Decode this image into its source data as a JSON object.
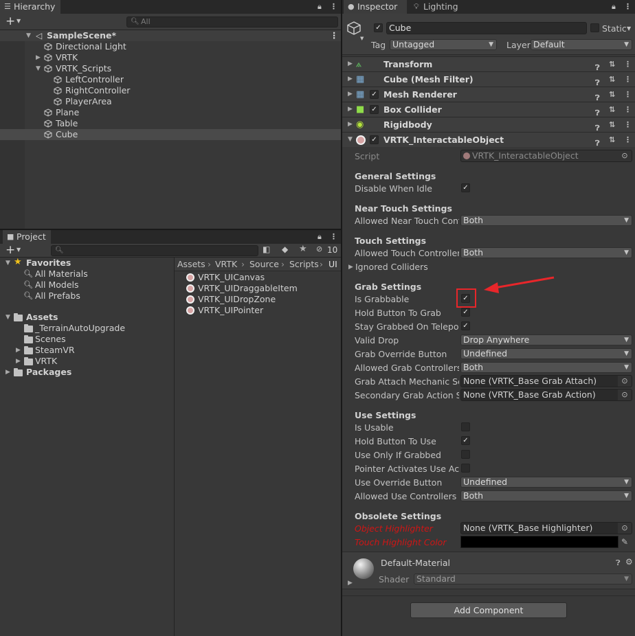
{
  "hierarchy": {
    "tab_label": "Hierarchy",
    "search_placeholder": "All",
    "add_button": "+",
    "scene_name": "SampleScene*",
    "items": [
      {
        "label": "Directional Light"
      },
      {
        "label": "VRTK"
      },
      {
        "label": "VRTK_Scripts"
      },
      {
        "label": "LeftController"
      },
      {
        "label": "RightController"
      },
      {
        "label": "PlayerArea"
      },
      {
        "label": "Plane"
      },
      {
        "label": "Table"
      },
      {
        "label": "Cube"
      }
    ]
  },
  "project": {
    "tab_label": "Project",
    "add_button": "+",
    "hidden_count": "10",
    "favorites_label": "Favorites",
    "favorites": [
      "All Materials",
      "All Models",
      "All Prefabs"
    ],
    "assets_label": "Assets",
    "asset_folders": [
      "_TerrainAutoUpgrade",
      "Scenes",
      "SteamVR",
      "VRTK"
    ],
    "packages_label": "Packages",
    "breadcrumb": [
      "Assets",
      "VRTK",
      "Source",
      "Scripts",
      "UI"
    ],
    "files": [
      "VRTK_UICanvas",
      "VRTK_UIDraggableItem",
      "VRTK_UIDropZone",
      "VRTK_UIPointer"
    ]
  },
  "inspector": {
    "tab_label": "Inspector",
    "lighting_tab_label": "Lighting",
    "object_name": "Cube",
    "static_label": "Static",
    "tag_label": "Tag",
    "tag_value": "Untagged",
    "layer_label": "Layer",
    "layer_value": "Default",
    "components": [
      {
        "name": "Transform"
      },
      {
        "name": "Cube (Mesh Filter)"
      },
      {
        "name": "Mesh Renderer"
      },
      {
        "name": "Box Collider"
      },
      {
        "name": "Rigidbody"
      },
      {
        "name": "VRTK_InteractableObject"
      }
    ],
    "script_label": "Script",
    "script_value": "VRTK_InteractableObject",
    "general": {
      "header": "General Settings",
      "disable_when_idle": "Disable When Idle"
    },
    "near_touch": {
      "header": "Near Touch Settings",
      "allowed_label": "Allowed Near Touch Contro",
      "allowed_value": "Both"
    },
    "touch": {
      "header": "Touch Settings",
      "allowed_label": "Allowed Touch Controllers",
      "allowed_value": "Both",
      "ignored_colliders": "Ignored Colliders"
    },
    "grab": {
      "header": "Grab Settings",
      "is_grabbable": "Is Grabbable",
      "hold_button": "Hold Button To Grab",
      "stay_grabbed": "Stay Grabbed On Teleport",
      "valid_drop": "Valid Drop",
      "valid_drop_value": "Drop Anywhere",
      "override_button": "Grab Override Button",
      "override_value": "Undefined",
      "allowed_controllers": "Allowed Grab Controllers",
      "allowed_value": "Both",
      "attach_mechanic": "Grab Attach Mechanic Scri",
      "attach_value": "None (VRTK_Base Grab Attach)",
      "secondary_action": "Secondary Grab Action Scr",
      "secondary_value": "None (VRTK_Base Grab Action)"
    },
    "use": {
      "header": "Use Settings",
      "is_usable": "Is Usable",
      "hold_button": "Hold Button To Use",
      "only_if_grabbed": "Use Only If Grabbed",
      "pointer_activates": "Pointer Activates Use Actio",
      "override_button": "Use Override Button",
      "override_value": "Undefined",
      "allowed_controllers": "Allowed Use Controllers",
      "allowed_value": "Both"
    },
    "obsolete": {
      "header": "Obsolete Settings",
      "object_highlighter": "Object Highlighter",
      "highlighter_value": "None (VRTK_Base Highlighter)",
      "touch_highlight_color": "Touch Highlight Color"
    },
    "material": {
      "name": "Default-Material",
      "shader_label": "Shader",
      "shader_value": "Standard"
    },
    "add_component": "Add Component"
  },
  "colors": {
    "highlight": "#e8262a",
    "obsolete_text": "#d01515",
    "checked": "#e6e6e6"
  }
}
